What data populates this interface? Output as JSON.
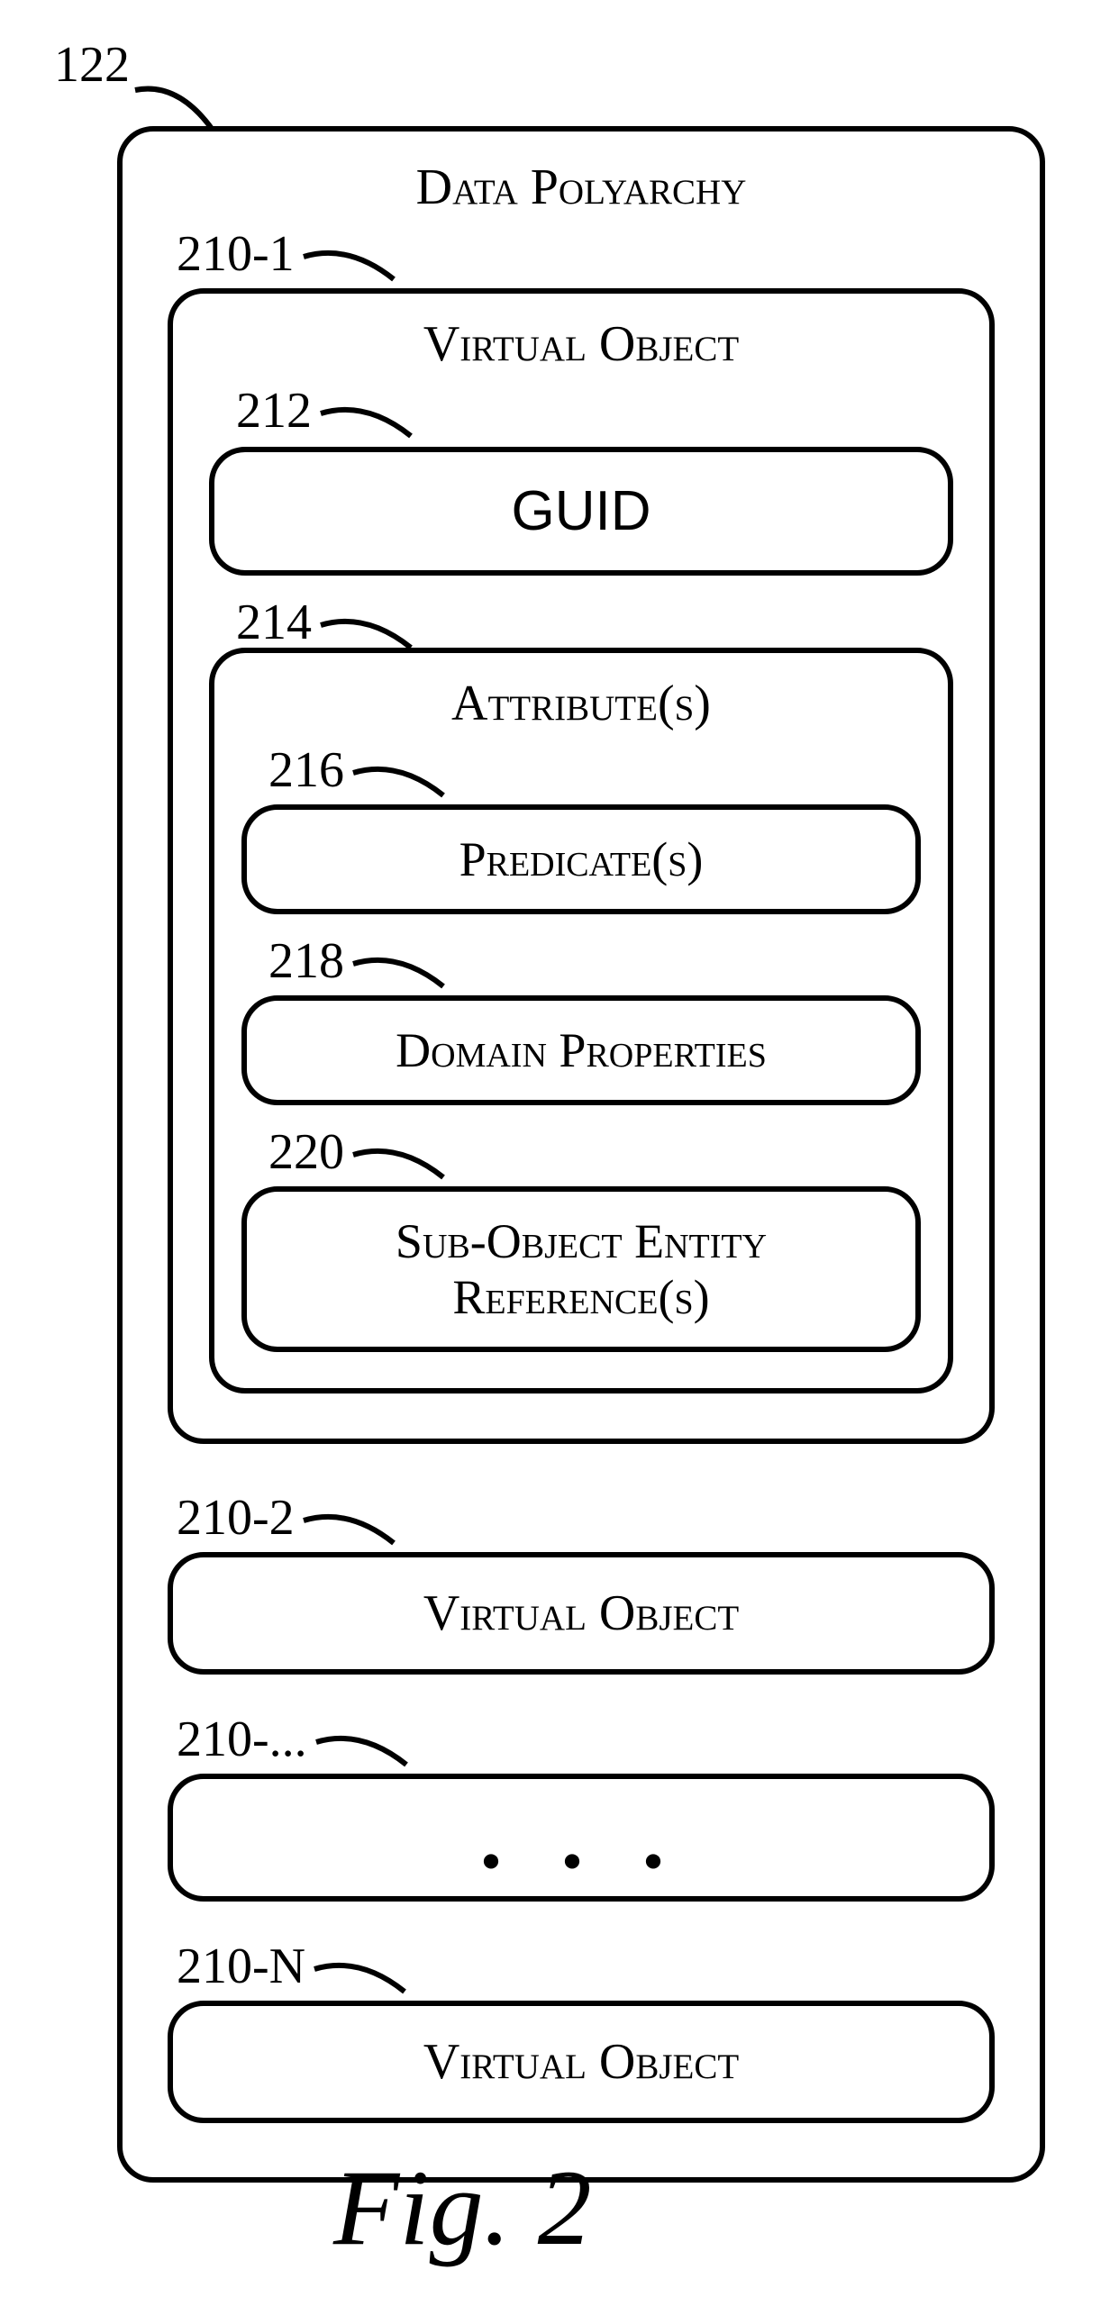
{
  "outer_ref": "122",
  "main_title": "Data Polyarchy",
  "virtual_object": {
    "ref_1": "210-1",
    "title": "Virtual Object",
    "guid": {
      "ref": "212",
      "text": "GUID"
    },
    "attributes": {
      "ref": "214",
      "title": "Attribute(s)",
      "predicates": {
        "ref": "216",
        "title": "Predicate(s)"
      },
      "domain_props": {
        "ref": "218",
        "title": "Domain Properties"
      },
      "sub_object": {
        "ref": "220",
        "title": "Sub-Object Entity Reference(s)"
      }
    }
  },
  "vo2": {
    "ref": "210-2",
    "title": "Virtual Object"
  },
  "vo_ellipsis": {
    "ref": "210-...",
    "dots": ". . ."
  },
  "voN": {
    "ref": "210-N",
    "title": "Virtual Object"
  },
  "figure": "Fig. 2"
}
